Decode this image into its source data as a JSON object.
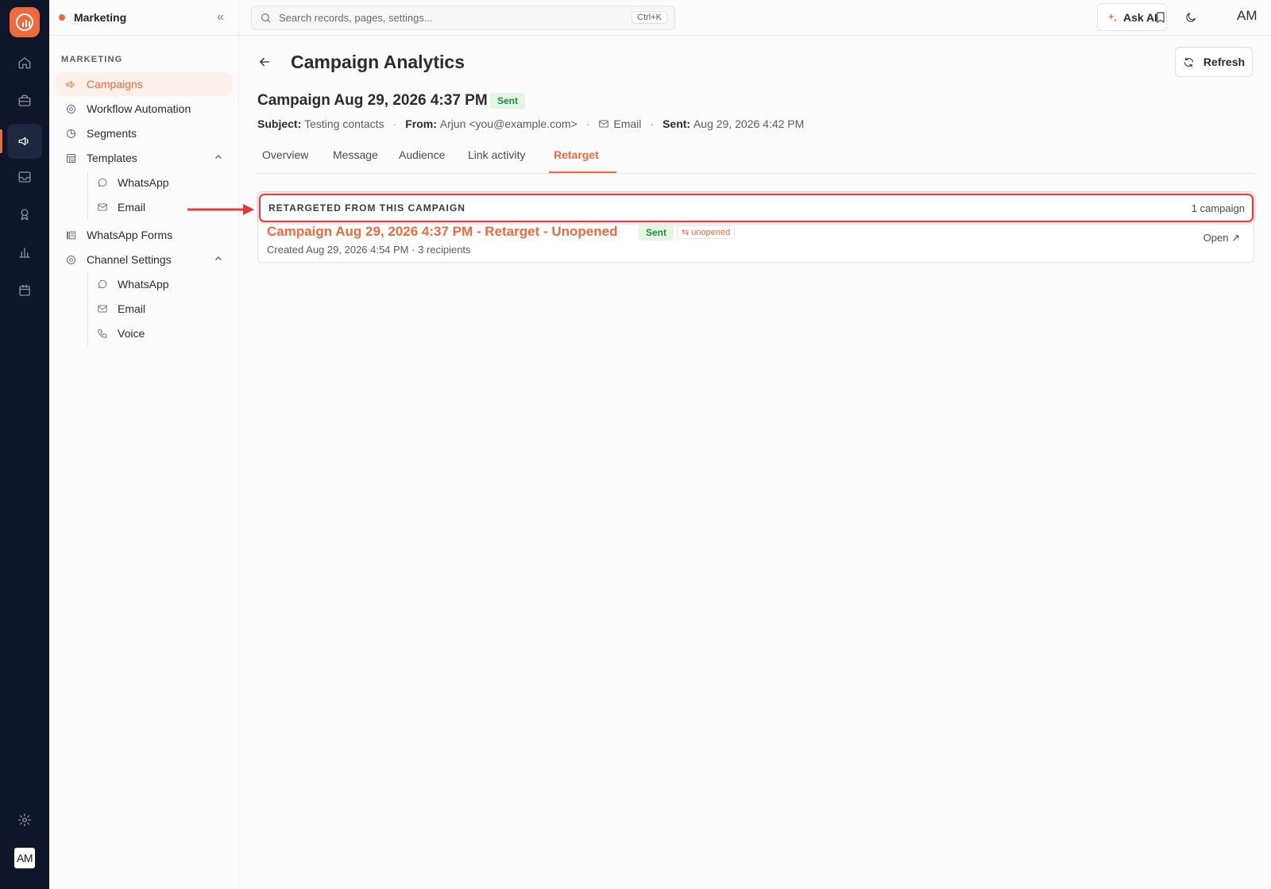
{
  "app": {
    "workspace": "Marketing",
    "avatar_initials": "AM",
    "accent_color": "#ef6a3d"
  },
  "rail": {
    "items": [
      "home-icon",
      "briefcase-icon",
      "megaphone-icon",
      "inbox-icon",
      "award-icon",
      "bar-chart-icon",
      "calendar-icon"
    ],
    "active": "megaphone-icon",
    "bottom": [
      "gear-icon",
      "avatar"
    ]
  },
  "sidebar": {
    "section": "MARKETING",
    "items": [
      {
        "label": "Campaigns",
        "icon": "megaphone-icon",
        "active": true
      },
      {
        "label": "Workflow Automation",
        "icon": "cog-icon"
      },
      {
        "label": "Segments",
        "icon": "pie-icon"
      },
      {
        "label": "Templates",
        "icon": "template-icon",
        "expanded": true,
        "children": [
          {
            "label": "WhatsApp",
            "icon": "whatsapp-icon"
          },
          {
            "label": "Email",
            "icon": "mail-icon"
          }
        ]
      },
      {
        "label": "WhatsApp Forms",
        "icon": "form-icon"
      },
      {
        "label": "Channel Settings",
        "icon": "cog-icon",
        "expanded": true,
        "children": [
          {
            "label": "WhatsApp",
            "icon": "whatsapp-icon"
          },
          {
            "label": "Email",
            "icon": "mail-icon"
          },
          {
            "label": "Voice",
            "icon": "phone-icon"
          }
        ]
      }
    ]
  },
  "topbar": {
    "search_placeholder": "Search records, pages, settings...",
    "search_shortcut": "Ctrl+K",
    "ask_ai": "Ask AI",
    "avatar": "AM"
  },
  "page": {
    "title": "Campaign Analytics",
    "refresh": "Refresh",
    "campaign": {
      "title": "Campaign Aug 29, 2026 4:37 PM",
      "status": "Sent",
      "subject_label": "Subject:",
      "subject": "Testing contacts",
      "from_label": "From:",
      "from": "Arjun <you@example.com>",
      "channel": "Email",
      "sent_label": "Sent:",
      "sent": "Aug 29, 2026 4:42 PM",
      "separator": "·"
    },
    "tabs": [
      "Overview",
      "Message",
      "Audience",
      "Link activity",
      "Retarget"
    ],
    "active_tab": "Retarget"
  },
  "retarget": {
    "header": "RETARGETED FROM THIS CAMPAIGN",
    "count": "1 campaign",
    "items": [
      {
        "title": "Campaign Aug 29, 2026 4:37 PM - Retarget - Unopened",
        "status": "Sent",
        "tag": "unopened",
        "subtitle": "Created Aug 29, 2026 4:54 PM · 3 recipients",
        "action": "Open"
      }
    ]
  }
}
